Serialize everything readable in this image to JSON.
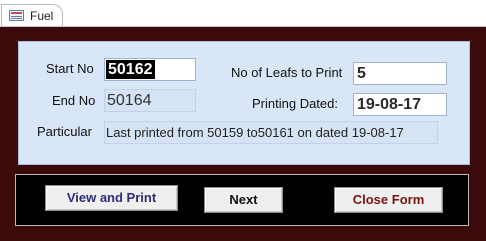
{
  "tab": {
    "label": "Fuel",
    "icon": "form-icon"
  },
  "form": {
    "start_no": {
      "label": "Start No",
      "value": "50162"
    },
    "end_no": {
      "label": "End No",
      "value": "50164"
    },
    "no_of_leafs": {
      "label": "No of Leafs to Print",
      "value": "5"
    },
    "printing_dated": {
      "label": "Printing Dated:",
      "value": "19-08-17"
    },
    "particular": {
      "label": "Particular",
      "value": "Last printed from 50159 to50161 on dated 19-08-17"
    }
  },
  "buttons": {
    "view_print": "View and Print",
    "next": "Next",
    "close_form": "Close Form"
  },
  "colors": {
    "frame": "#3b0a0a",
    "panel": "#d9e6f7",
    "button_bar": "#000000",
    "view_text": "#2e2e78",
    "close_text": "#7a1313"
  }
}
